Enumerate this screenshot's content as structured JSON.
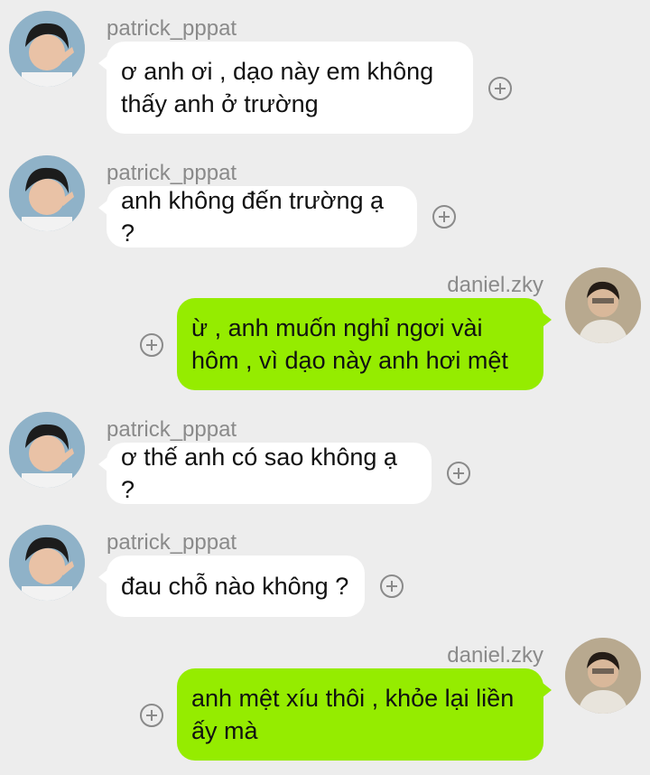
{
  "colors": {
    "background": "#ededed",
    "incoming_bubble": "#ffffff",
    "outgoing_bubble": "#95ec00",
    "sender_name": "#8a8a8a",
    "icon": "#8a8a8a"
  },
  "messages": [
    {
      "direction": "incoming",
      "sender": "patrick_pppat",
      "text": "ơ anh ơi , dạo này em không\nthấy anh ở trường",
      "avatar_icon": "avatar-patrick",
      "action_icon": "add-reaction-icon"
    },
    {
      "direction": "incoming",
      "sender": "patrick_pppat",
      "text": "anh không đến trường ạ ?",
      "avatar_icon": "avatar-patrick",
      "action_icon": "add-reaction-icon"
    },
    {
      "direction": "outgoing",
      "sender": "daniel.zky",
      "text": "ừ , anh muốn nghỉ ngơi vài\nhôm , vì dạo này anh hơi mệt",
      "avatar_icon": "avatar-daniel",
      "action_icon": "add-reaction-icon"
    },
    {
      "direction": "incoming",
      "sender": "patrick_pppat",
      "text": "ơ thế anh có sao không ạ ?",
      "avatar_icon": "avatar-patrick",
      "action_icon": "add-reaction-icon"
    },
    {
      "direction": "incoming",
      "sender": "patrick_pppat",
      "text": "đau chỗ nào không ?",
      "avatar_icon": "avatar-patrick",
      "action_icon": "add-reaction-icon"
    },
    {
      "direction": "outgoing",
      "sender": "daniel.zky",
      "text": "anh mệt xíu thôi , khỏe lại liền\nấy mà",
      "avatar_icon": "avatar-daniel",
      "action_icon": "add-reaction-icon"
    }
  ]
}
